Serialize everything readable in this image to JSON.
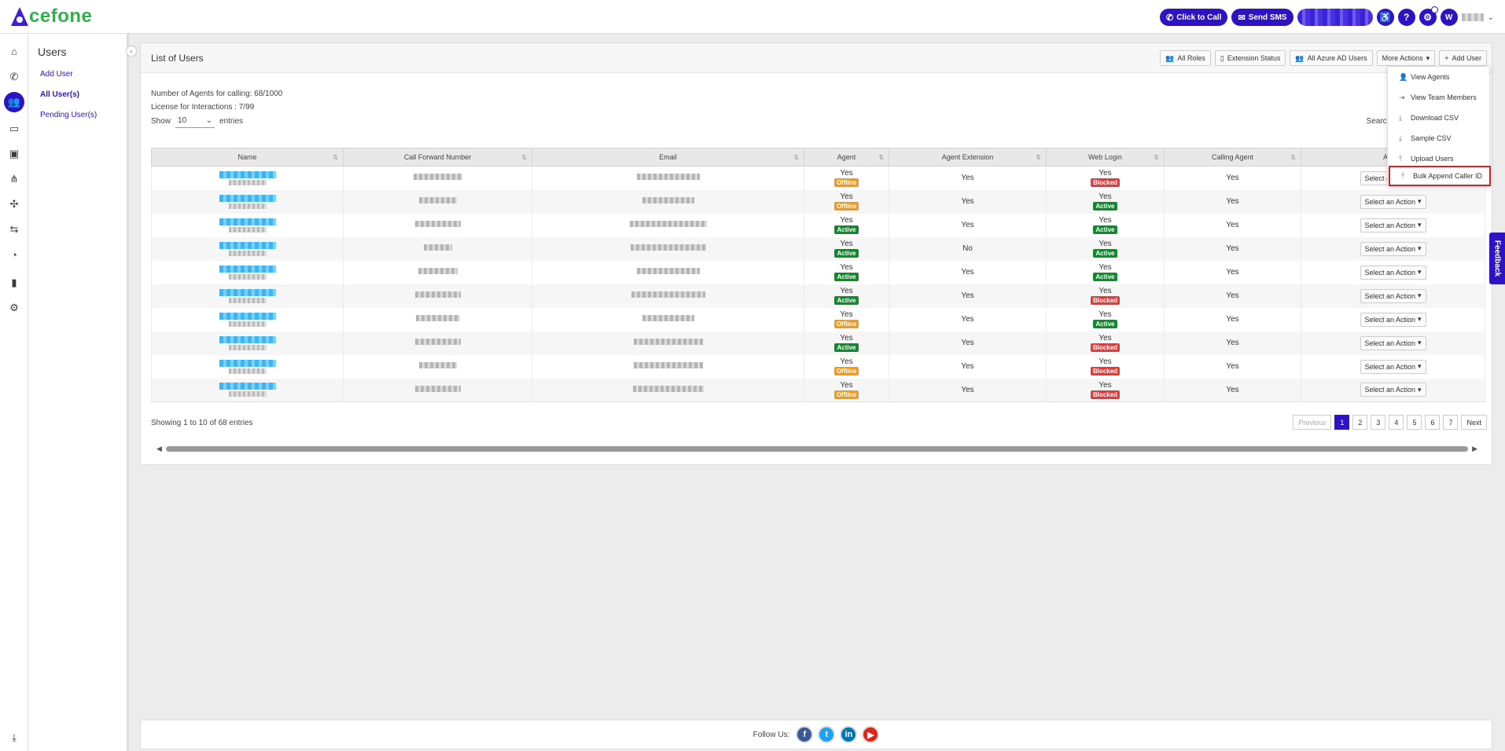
{
  "brand": {
    "logo_text": "cefone"
  },
  "topbar": {
    "click_to_call": "Click to Call",
    "send_sms": "Send SMS",
    "user_initial": "W"
  },
  "subnav": {
    "title": "Users",
    "items": [
      {
        "label": "Add User"
      },
      {
        "label": "All User(s)"
      },
      {
        "label": "Pending User(s)"
      }
    ]
  },
  "panel": {
    "title": "List of Users",
    "buttons": {
      "all_roles": "All Roles",
      "extension_status": "Extension Status",
      "all_azure": "All Azure AD Users",
      "more_actions": "More Actions",
      "add_user": "Add User"
    },
    "agents_line": "Number of Agents for calling: 68/1000",
    "license_line": "License for Interactions : 7/99",
    "show_label": "Show",
    "show_value": "10",
    "entries_label": "entries",
    "search_label": "Search:"
  },
  "dropdown": {
    "items": [
      {
        "label": "View Agents"
      },
      {
        "label": "View Team Members"
      },
      {
        "label": "Download CSV"
      },
      {
        "label": "Sample CSV"
      },
      {
        "label": "Upload Users"
      },
      {
        "label": "Bulk Append Caller ID"
      }
    ]
  },
  "table": {
    "headers": [
      "Name",
      "Call Forward Number",
      "Email",
      "Agent",
      "Agent Extension",
      "Web Login",
      "Calling Agent",
      "Action"
    ],
    "rows": [
      {
        "agent": "Yes",
        "agent_status": "Offline",
        "extension": "Yes",
        "web": "Yes",
        "web_status": "Blocked",
        "calling": "Yes",
        "action": "Select an Action"
      },
      {
        "agent": "Yes",
        "agent_status": "Offline",
        "extension": "Yes",
        "web": "Yes",
        "web_status": "Active",
        "calling": "Yes",
        "action": "Select an Action"
      },
      {
        "agent": "Yes",
        "agent_status": "Active",
        "extension": "Yes",
        "web": "Yes",
        "web_status": "Active",
        "calling": "Yes",
        "action": "Select an Action"
      },
      {
        "agent": "Yes",
        "agent_status": "Active",
        "extension": "No",
        "web": "Yes",
        "web_status": "Active",
        "calling": "Yes",
        "action": "Select an Action"
      },
      {
        "agent": "Yes",
        "agent_status": "Active",
        "extension": "Yes",
        "web": "Yes",
        "web_status": "Active",
        "calling": "Yes",
        "action": "Select an Action"
      },
      {
        "agent": "Yes",
        "agent_status": "Active",
        "extension": "Yes",
        "web": "Yes",
        "web_status": "Blocked",
        "calling": "Yes",
        "action": "Select an Action"
      },
      {
        "agent": "Yes",
        "agent_status": "Offline",
        "extension": "Yes",
        "web": "Yes",
        "web_status": "Active",
        "calling": "Yes",
        "action": "Select an Action"
      },
      {
        "agent": "Yes",
        "agent_status": "Active",
        "extension": "Yes",
        "web": "Yes",
        "web_status": "Blocked",
        "calling": "Yes",
        "action": "Select an Action"
      },
      {
        "agent": "Yes",
        "agent_status": "Offline",
        "extension": "Yes",
        "web": "Yes",
        "web_status": "Blocked",
        "calling": "Yes",
        "action": "Select an Action"
      },
      {
        "agent": "Yes",
        "agent_status": "Offline",
        "extension": "Yes",
        "web": "Yes",
        "web_status": "Blocked",
        "calling": "Yes",
        "action": "Select an Action"
      }
    ]
  },
  "pagination": {
    "summary": "Showing 1 to 10 of 68 entries",
    "previous": "Previous",
    "pages": [
      "1",
      "2",
      "3",
      "4",
      "5",
      "6",
      "7"
    ],
    "current": "1",
    "next": "Next"
  },
  "feedback": "Feedback",
  "footer": {
    "follow": "Follow Us:",
    "social": [
      {
        "glyph": "f",
        "color": "#3b5998"
      },
      {
        "glyph": "t",
        "color": "#1da1f2"
      },
      {
        "glyph": "in",
        "color": "#0077b5"
      },
      {
        "glyph": "▶",
        "color": "#e62117"
      }
    ]
  },
  "colors": {
    "brand_primary": "#2e13c4",
    "logo_green": "#2bb34a",
    "offline": "#f39a1e",
    "active": "#118a2d",
    "blocked": "#e63939",
    "highlight": "#d61f1f"
  }
}
